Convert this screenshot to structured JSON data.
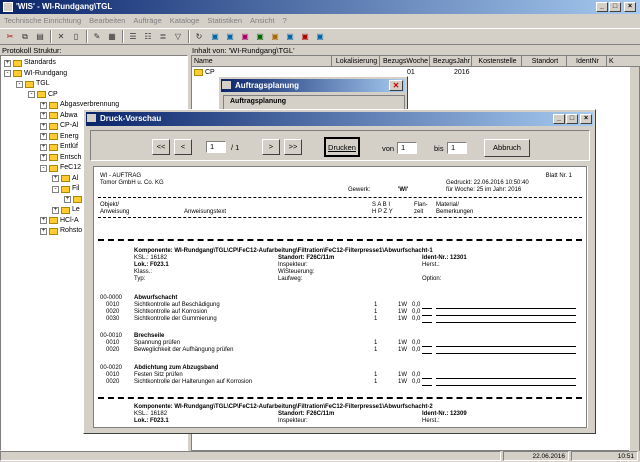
{
  "app": {
    "title": "'WIS' - WI-Rundgang\\TGL",
    "menu": [
      "Technische Einrichtung",
      "Bearbeiten",
      "Aufträge",
      "Kataloge",
      "Statistiken",
      "Ansicht",
      "?"
    ]
  },
  "left_panel": {
    "label": "Protokoll Struktur:",
    "tree": [
      {
        "label": "Standards",
        "level": 0,
        "sign": "+"
      },
      {
        "label": "WI-Rundgang",
        "level": 0,
        "sign": "-"
      },
      {
        "label": "TGL",
        "level": 1,
        "sign": "-"
      },
      {
        "label": "CP",
        "level": 2,
        "sign": "-"
      },
      {
        "label": "Abgasverbrennung",
        "level": 3,
        "sign": "+"
      },
      {
        "label": "Abwa",
        "level": 3,
        "sign": "+"
      },
      {
        "label": "CP-Al",
        "level": 3,
        "sign": "+"
      },
      {
        "label": "Energ",
        "level": 3,
        "sign": "+"
      },
      {
        "label": "Entlüf",
        "level": 3,
        "sign": "+"
      },
      {
        "label": "Entsch",
        "level": 3,
        "sign": "+"
      },
      {
        "label": "FeC12",
        "level": 3,
        "sign": "-"
      },
      {
        "label": "Al",
        "level": 4,
        "sign": "+"
      },
      {
        "label": "Fil",
        "level": 4,
        "sign": "-"
      },
      {
        "label": "",
        "level": 5,
        "sign": "+"
      },
      {
        "label": "Le",
        "level": 4,
        "sign": "+"
      },
      {
        "label": "HCl-A",
        "level": 3,
        "sign": "+"
      },
      {
        "label": "Rohsto",
        "level": 3,
        "sign": "+"
      }
    ]
  },
  "right_panel": {
    "label": "Inhalt von: 'WI-Rundgang\\TGL'",
    "columns": [
      "Name",
      "Lokalisierung",
      "BezugsWoche",
      "BezugsJahr",
      "Kostenstelle",
      "Standort",
      "IdentNr",
      "K"
    ],
    "rows": [
      {
        "name": "CP",
        "woche": "01",
        "jahr": "2016"
      }
    ]
  },
  "dialog_auftrag": {
    "title": "Auftragsplanung",
    "group_label": "Auftragsplanung"
  },
  "preview": {
    "title": "Druck-Vorschau",
    "nav": {
      "first": "<<",
      "prev": "<",
      "page": "1",
      "of": "/ 1",
      "next": ">",
      "last": ">>"
    },
    "print_button": "Drucken",
    "from_label": "von",
    "from_value": "1",
    "to_label": "bis",
    "to_value": "1",
    "cancel_button": "Abbruch",
    "doc": {
      "header_left1": "WI - AUFTRAG",
      "header_left2": "Tomor GmbH u. Co. KG",
      "blatt": "Blatt Nr.  1",
      "gedruckt": "Gedruckt:   22.06.2016 10:50:40",
      "fuer_woche": "für Woche: 25     im Jahr: 2016",
      "gewerk_label": "Gewerk:",
      "gewerk_value": "'WI'",
      "col_objekt": "Objekt/",
      "col_anweisung": "Anweisung",
      "col_text": "Anweisungstext",
      "col_sabi1": "S  A  B  I",
      "col_sabi2": "H  P  Z  Y",
      "col_flan1": "Flan-",
      "col_flan2": "zeit",
      "col_mat1": "Material/",
      "col_mat2": "Bemerkungen",
      "comp1": {
        "title": "Komponente: WI-Rundgang\\TGL\\CP\\FeC12-Aufarbeitung\\Filtration\\FeC12-Filterpresse1\\Abwurfschacht-1",
        "ksl": "KSL.:  16182",
        "standort": "Standort:  F26C/11m",
        "ident": "Ident-Nr.:  12301",
        "lok": "Lok.:  F023.1",
        "inspekteur": "Inspekteur:",
        "herst": "Herst.:",
        "klass": "Klass.:",
        "wisteuerung": "WiSteuerung:",
        "typ": "Typ:",
        "laufweg": "Laufweg:",
        "option": "Option:"
      },
      "groups": [
        {
          "code": "00-0000",
          "title": "Abwurfschacht",
          "items": [
            {
              "code": "0010",
              "text": "Sichtkontrolle auf Beschädigung",
              "n": "1",
              "w": "1W",
              "v": "0,0"
            },
            {
              "code": "0020",
              "text": "Sichtkontrolle auf Korrosion",
              "n": "1",
              "w": "1W",
              "v": "0,0"
            },
            {
              "code": "0030",
              "text": "Sichtkontrolle der Gummierung",
              "n": "1",
              "w": "1W",
              "v": "0,0"
            }
          ]
        },
        {
          "code": "00-0010",
          "title": "Brechseile",
          "items": [
            {
              "code": "0010",
              "text": "Spannung prüfen",
              "n": "1",
              "w": "1W",
              "v": "0,0"
            },
            {
              "code": "0020",
              "text": "Beweglichkeit der Aufhängung prüfen",
              "n": "1",
              "w": "1W",
              "v": "0,0"
            }
          ]
        },
        {
          "code": "00-0020",
          "title": "Abdichtung zum Abzugsband",
          "items": [
            {
              "code": "0010",
              "text": "Festen Sitz prüfen",
              "n": "1",
              "w": "1W",
              "v": "0,0"
            },
            {
              "code": "0020",
              "text": "Sichtkontrolle der Halterungen auf Korrosion",
              "n": "1",
              "w": "1W",
              "v": "0,0"
            }
          ]
        }
      ],
      "comp2": {
        "title": "Komponente: WI-Rundgang\\TGL\\CP\\FeC12-Aufarbeitung\\Filtration\\FeC12-Filterpresse1\\Abwurfschacht-2",
        "ksl": "KSL.:  16182",
        "standort": "Standort:  F26C/11m",
        "ident": "Ident-Nr.:  12309",
        "lok": "Lok.:  F023.1",
        "inspekteur": "Inspekteur:",
        "herst": "Herst.:"
      }
    }
  },
  "status": {
    "date": "22.06.2016",
    "time": "10:51"
  },
  "colors": {
    "titlebar": "#0a246a",
    "face": "#d4d0c8"
  }
}
